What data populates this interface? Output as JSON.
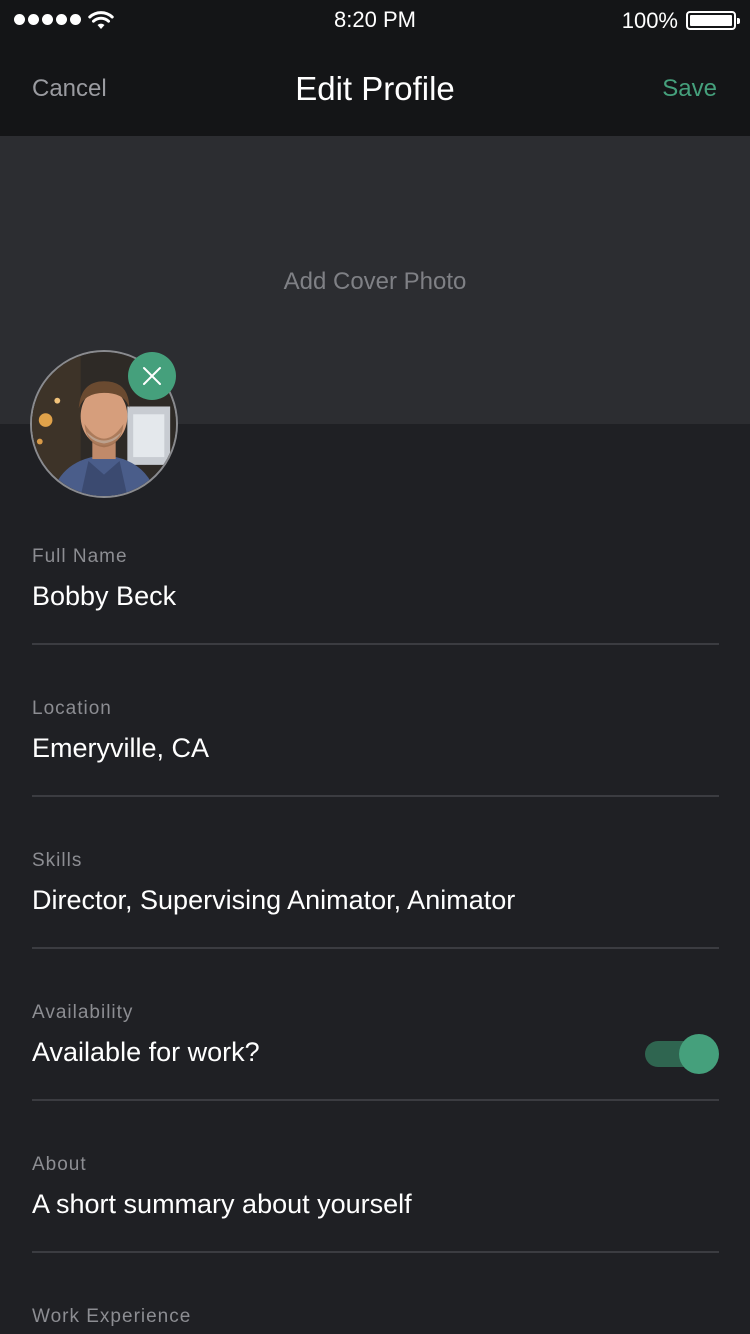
{
  "status_bar": {
    "time": "8:20 PM",
    "battery": "100%",
    "signal_icon": "signal-dots-icon",
    "wifi_icon": "wifi-icon",
    "battery_icon": "battery-full-icon"
  },
  "nav": {
    "cancel_label": "Cancel",
    "title": "Edit Profile",
    "save_label": "Save"
  },
  "cover": {
    "add_label": "Add Cover Photo"
  },
  "avatar": {
    "remove_icon": "close-icon"
  },
  "fields": {
    "full_name": {
      "label": "Full Name",
      "value": "Bobby Beck"
    },
    "location": {
      "label": "Location",
      "value": "Emeryville, CA"
    },
    "skills": {
      "label": "Skills",
      "value": "Director, Supervising Animator, Animator"
    },
    "availability": {
      "label": "Availability",
      "value": "Available for work?",
      "toggle_on": true
    },
    "about": {
      "label": "About",
      "placeholder": "A short summary about yourself"
    },
    "work_experience": {
      "label": "Work Experience"
    }
  },
  "colors": {
    "accent": "#45a07c",
    "background": "#1f2024",
    "header": "#141517",
    "cover": "#2c2d31"
  }
}
